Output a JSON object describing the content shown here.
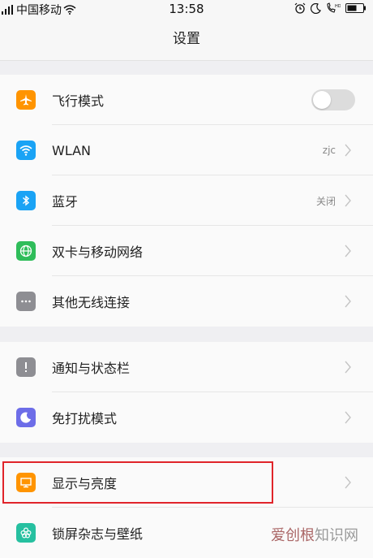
{
  "status_bar": {
    "carrier": "中国移动",
    "time": "13:58"
  },
  "header": {
    "title": "设置"
  },
  "groups": [
    {
      "items": [
        {
          "label": "飞行模式",
          "icon": "airplane-icon",
          "icon_color": "#ff9400",
          "control": "toggle",
          "toggle_on": false
        },
        {
          "label": "WLAN",
          "icon": "wifi-icon",
          "icon_color": "#1aa3f5",
          "value": "zjc"
        },
        {
          "label": "蓝牙",
          "icon": "bluetooth-icon",
          "icon_color": "#1aa3f5",
          "value": "关闭"
        },
        {
          "label": "双卡与移动网络",
          "icon": "globe-icon",
          "icon_color": "#2fbd5a"
        },
        {
          "label": "其他无线连接",
          "icon": "more-icon",
          "icon_color": "#8e8e93"
        }
      ]
    },
    {
      "items": [
        {
          "label": "通知与状态栏",
          "icon": "exclamation-icon",
          "icon_color": "#8e8e93"
        },
        {
          "label": "免打扰模式",
          "icon": "moon-icon",
          "icon_color": "#6d6de8"
        }
      ]
    },
    {
      "items": [
        {
          "label": "显示与亮度",
          "icon": "monitor-icon",
          "icon_color": "#ff9400"
        },
        {
          "label": "锁屏杂志与壁纸",
          "icon": "flower-icon",
          "icon_color": "#26c0a0"
        }
      ]
    }
  ],
  "watermark": {
    "brand": "爱创根",
    "suffix": "知识网"
  },
  "colors": {
    "highlight": "#e0242a",
    "background": "#efeff2"
  }
}
